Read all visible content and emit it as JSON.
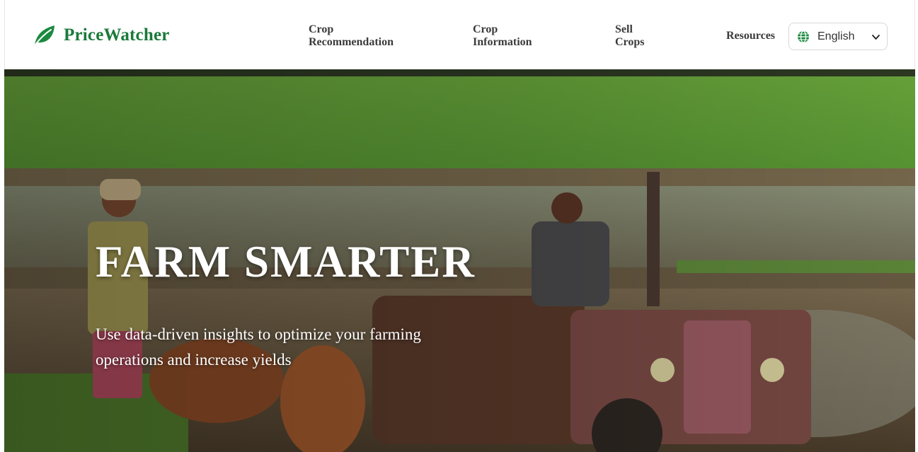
{
  "brand": {
    "name": "PriceWatcher",
    "logo_icon": "leaf-icon",
    "color": "#1b7a3a"
  },
  "nav": {
    "crop_recommendation": [
      "Crop",
      "Recommendation"
    ],
    "crop_information": [
      "Crop",
      "Information"
    ],
    "sell_crops": [
      "Sell",
      "Crops"
    ],
    "resources": "Resources"
  },
  "language_select": {
    "icon": "globe-icon",
    "value": "English",
    "chevron": "chevron-down-icon"
  },
  "hero": {
    "title": "FARM SMARTER",
    "subtitle": "Use data-driven insights to optimize your farming operations and increase yields",
    "image_icon": "farm-field-photo"
  }
}
